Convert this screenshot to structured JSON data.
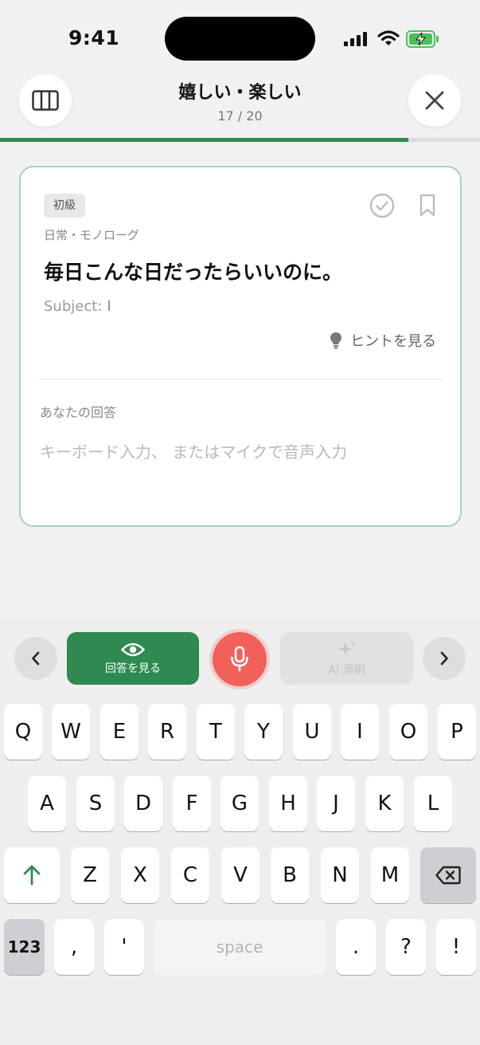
{
  "status_bar": {
    "time": "9:41"
  },
  "header": {
    "title": "嬉しい・楽しい",
    "progress_text": "17 / 20",
    "progress": {
      "current": 17,
      "total": 20
    }
  },
  "card": {
    "level": "初級",
    "category": "日常・モノローグ",
    "sentence": "毎日こんな日だったらいいのに。",
    "subject_label": "Subject:",
    "subject_value": "I",
    "hint_label": "ヒントを見る",
    "answer_label": "あなたの回答",
    "answer_placeholder": "キーボード入力、 またはマイクで音声入力",
    "answer_value": ""
  },
  "toolbar": {
    "show_answer_label": "回答を見る",
    "ai_label": "AI 添削"
  },
  "keyboard": {
    "row1": [
      "Q",
      "W",
      "E",
      "R",
      "T",
      "Y",
      "U",
      "I",
      "O",
      "P"
    ],
    "row2": [
      "A",
      "S",
      "D",
      "F",
      "G",
      "H",
      "J",
      "K",
      "L"
    ],
    "row3": [
      "Z",
      "X",
      "C",
      "V",
      "B",
      "N",
      "M"
    ],
    "numbers_label": "123",
    "comma": ",",
    "apostrophe": "'",
    "space_label": "space",
    "period": ".",
    "question": "?",
    "exclamation": "!"
  },
  "colors": {
    "accent": "#2e8a50",
    "mic": "#f2605a",
    "card_border": "#a9d3b5",
    "background": "#f1f1f4"
  }
}
